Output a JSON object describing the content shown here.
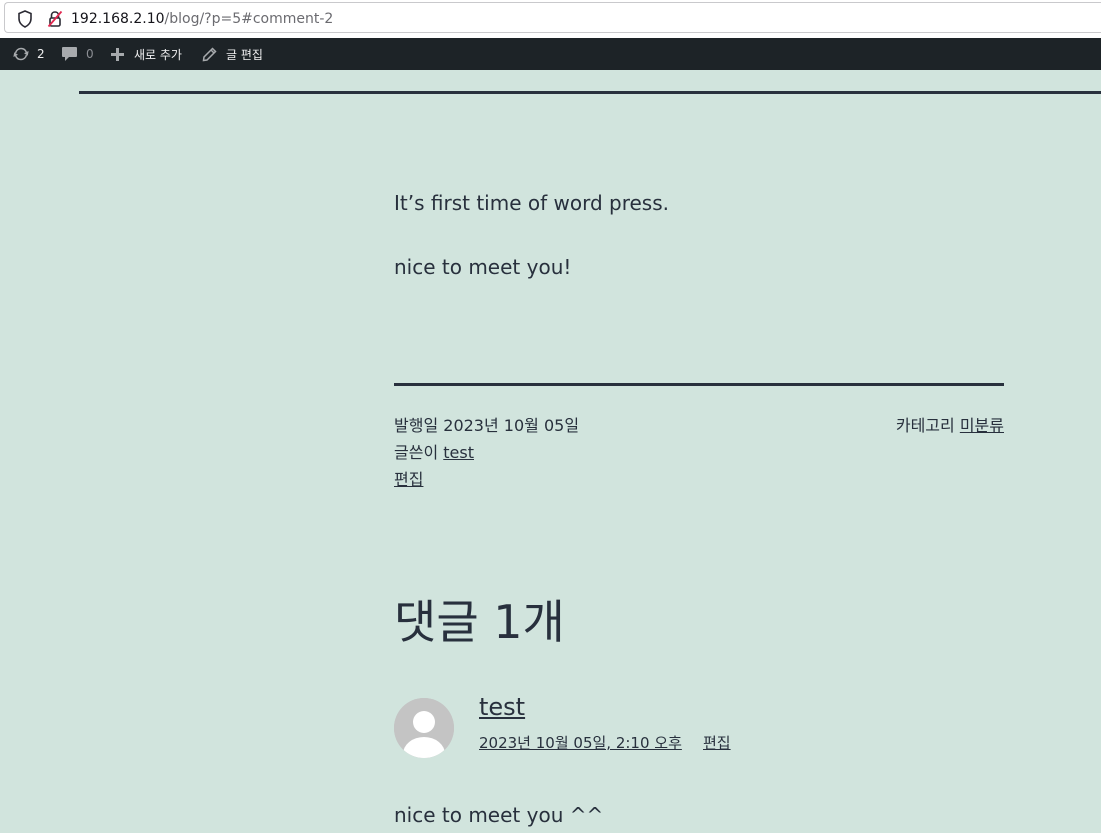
{
  "browser": {
    "url_host": "192.168.2.10",
    "url_path": "/blog/?p=5#comment-2"
  },
  "adminbar": {
    "updates_count": "2",
    "comments_count": "0",
    "new_label": "새로 추가",
    "edit_post_label": "글 편집"
  },
  "post": {
    "paragraphs": [
      "It’s first time of word press.",
      "nice to meet you!"
    ],
    "meta": {
      "published_prefix": "발행일",
      "published_date": "2023년 10월 05일",
      "author_prefix": "글쓴이",
      "author": "test",
      "edit_label": "편집",
      "category_prefix": "카테고리",
      "category": "미분류"
    }
  },
  "comments": {
    "title": "댓글 1개",
    "items": [
      {
        "author": "test",
        "date": "2023년 10월 05일, 2:10 오후",
        "edit_label": "편집",
        "body": "nice to meet you ^^"
      }
    ]
  },
  "colors": {
    "background": "#d1e4dd",
    "text": "#28303d",
    "adminbar": "#1d2327"
  }
}
